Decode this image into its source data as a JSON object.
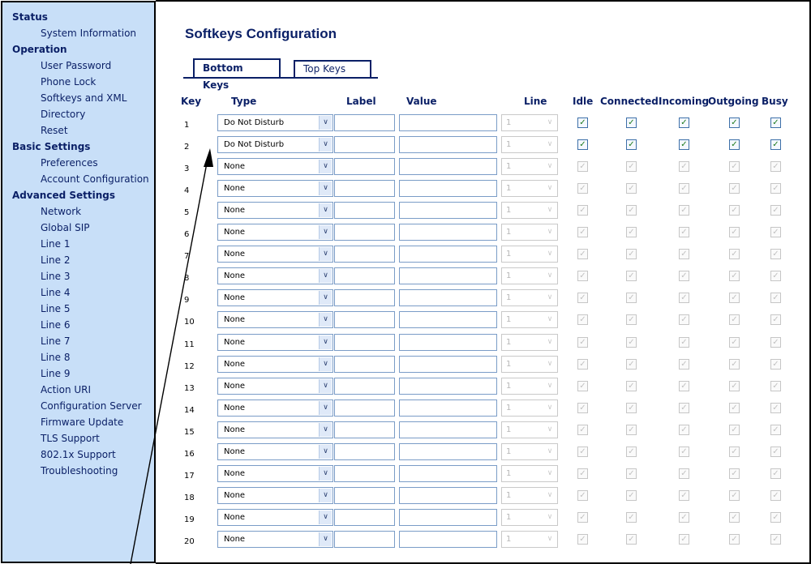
{
  "sidebar": {
    "sections": [
      {
        "title": "Status",
        "items": [
          "System Information"
        ]
      },
      {
        "title": "Operation",
        "items": [
          "User Password",
          "Phone Lock",
          "Softkeys and XML",
          "Directory",
          "Reset"
        ]
      },
      {
        "title": "Basic Settings",
        "items": [
          "Preferences",
          "Account Configuration"
        ]
      },
      {
        "title": "Advanced Settings",
        "items": [
          "Network",
          "Global SIP",
          "Line 1",
          "Line 2",
          "Line 3",
          "Line 4",
          "Line 5",
          "Line 6",
          "Line 7",
          "Line 8",
          "Line 9",
          "Action URI",
          "Configuration Server",
          "Firmware Update",
          "TLS Support",
          "802.1x Support",
          "Troubleshooting"
        ]
      }
    ]
  },
  "main": {
    "title": "Softkeys Configuration",
    "tabs": {
      "bottom": "Bottom Keys",
      "top": "Top Keys"
    },
    "headers": {
      "key": "Key",
      "type": "Type",
      "label": "Label",
      "value": "Value",
      "line": "Line",
      "idle": "Idle",
      "connected": "Connected",
      "incoming": "Incoming",
      "outgoing": "Outgoing",
      "busy": "Busy"
    },
    "rows": [
      {
        "key": "1",
        "type": "Do Not Disturb",
        "line": "1",
        "enabled": true
      },
      {
        "key": "2",
        "type": "Do Not Disturb",
        "line": "1",
        "enabled": true
      },
      {
        "key": "3",
        "type": "None",
        "line": "1",
        "enabled": false
      },
      {
        "key": "4",
        "type": "None",
        "line": "1",
        "enabled": false
      },
      {
        "key": "5",
        "type": "None",
        "line": "1",
        "enabled": false
      },
      {
        "key": "6",
        "type": "None",
        "line": "1",
        "enabled": false
      },
      {
        "key": "7",
        "type": "None",
        "line": "1",
        "enabled": false
      },
      {
        "key": "8",
        "type": "None",
        "line": "1",
        "enabled": false
      },
      {
        "key": "9",
        "type": "None",
        "line": "1",
        "enabled": false
      },
      {
        "key": "10",
        "type": "None",
        "line": "1",
        "enabled": false
      },
      {
        "key": "11",
        "type": "None",
        "line": "1",
        "enabled": false
      },
      {
        "key": "12",
        "type": "None",
        "line": "1",
        "enabled": false
      },
      {
        "key": "13",
        "type": "None",
        "line": "1",
        "enabled": false
      },
      {
        "key": "14",
        "type": "None",
        "line": "1",
        "enabled": false
      },
      {
        "key": "15",
        "type": "None",
        "line": "1",
        "enabled": false
      },
      {
        "key": "16",
        "type": "None",
        "line": "1",
        "enabled": false
      },
      {
        "key": "17",
        "type": "None",
        "line": "1",
        "enabled": false
      },
      {
        "key": "18",
        "type": "None",
        "line": "1",
        "enabled": false
      },
      {
        "key": "19",
        "type": "None",
        "line": "1",
        "enabled": false
      },
      {
        "key": "20",
        "type": "None",
        "line": "1",
        "enabled": false
      }
    ]
  },
  "icons": {
    "dropdown": "chevron-down-icon",
    "check": "check-icon",
    "pointer": "arrow-pointer-icon"
  },
  "colors": {
    "sidebar_bg": "#c8dff8",
    "nav_text": "#0a1f66",
    "check": "#1c7a1c"
  }
}
